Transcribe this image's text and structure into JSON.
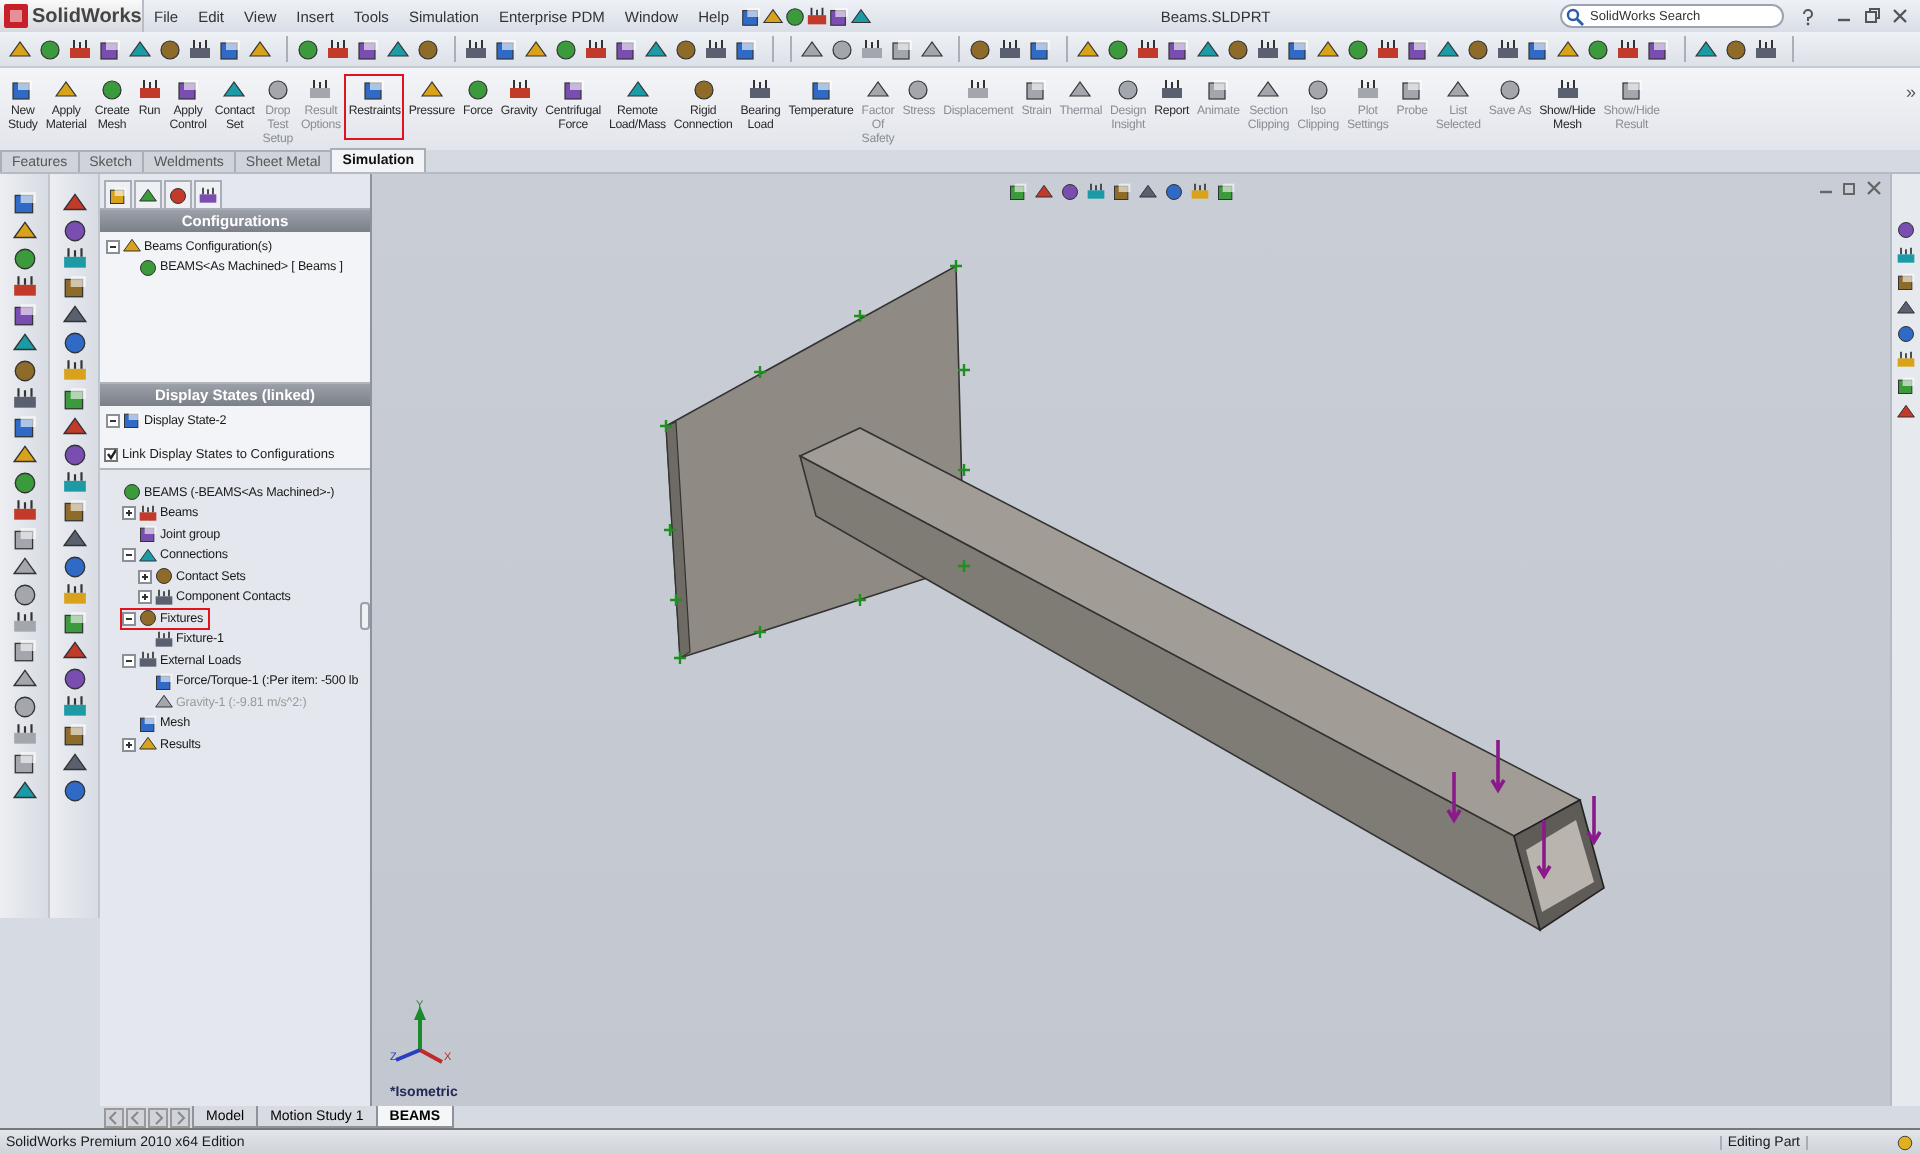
{
  "app": {
    "logo": "SolidWorks",
    "menu": [
      "File",
      "Edit",
      "View",
      "Insert",
      "Tools",
      "Simulation",
      "Enterprise PDM",
      "Window",
      "Help"
    ],
    "title": "Beams.SLDPRT",
    "search": {
      "placeholder": "SolidWorks Search"
    }
  },
  "commands": [
    {
      "label": "New\nStudy",
      "disabled": false,
      "highlighted": false
    },
    {
      "label": "Apply\nMaterial",
      "disabled": false,
      "highlighted": false
    },
    {
      "label": "Create\nMesh",
      "disabled": false,
      "highlighted": false
    },
    {
      "label": "Run",
      "disabled": false,
      "highlighted": false
    },
    {
      "label": "Apply\nControl",
      "disabled": false,
      "highlighted": false
    },
    {
      "label": "Contact\nSet",
      "disabled": false,
      "highlighted": false
    },
    {
      "label": "Drop\nTest\nSetup",
      "disabled": true,
      "highlighted": false
    },
    {
      "label": "Result\nOptions",
      "disabled": true,
      "highlighted": false
    },
    {
      "label": "Restraints",
      "disabled": false,
      "highlighted": true
    },
    {
      "label": "Pressure",
      "disabled": false,
      "highlighted": false
    },
    {
      "label": "Force",
      "disabled": false,
      "highlighted": false
    },
    {
      "label": "Gravity",
      "disabled": false,
      "highlighted": false
    },
    {
      "label": "Centrifugal\nForce",
      "disabled": false,
      "highlighted": false
    },
    {
      "label": "Remote\nLoad/Mass",
      "disabled": false,
      "highlighted": false
    },
    {
      "label": "Rigid\nConnection",
      "disabled": false,
      "highlighted": false
    },
    {
      "label": "Bearing\nLoad",
      "disabled": false,
      "highlighted": false
    },
    {
      "label": "Temperature",
      "disabled": false,
      "highlighted": false
    },
    {
      "label": "Factor\nOf\nSafety",
      "disabled": true,
      "highlighted": false
    },
    {
      "label": "Stress",
      "disabled": true,
      "highlighted": false
    },
    {
      "label": "Displacement",
      "disabled": true,
      "highlighted": false
    },
    {
      "label": "Strain",
      "disabled": true,
      "highlighted": false
    },
    {
      "label": "Thermal",
      "disabled": true,
      "highlighted": false
    },
    {
      "label": "Design\nInsight",
      "disabled": true,
      "highlighted": false
    },
    {
      "label": "Report",
      "disabled": false,
      "highlighted": false
    },
    {
      "label": "Animate",
      "disabled": true,
      "highlighted": false
    },
    {
      "label": "Section\nClipping",
      "disabled": true,
      "highlighted": false
    },
    {
      "label": "Iso\nClipping",
      "disabled": true,
      "highlighted": false
    },
    {
      "label": "Plot\nSettings",
      "disabled": true,
      "highlighted": false
    },
    {
      "label": "Probe",
      "disabled": true,
      "highlighted": false
    },
    {
      "label": "List\nSelected",
      "disabled": true,
      "highlighted": false
    },
    {
      "label": "Save As",
      "disabled": true,
      "highlighted": false
    },
    {
      "label": "Show/Hide\nMesh",
      "disabled": false,
      "highlighted": false
    },
    {
      "label": "Show/Hide\nResult",
      "disabled": true,
      "highlighted": false
    }
  ],
  "more": "»",
  "tabs": [
    {
      "label": "Features",
      "selected": false
    },
    {
      "label": "Sketch",
      "selected": false
    },
    {
      "label": "Weldments",
      "selected": false
    },
    {
      "label": "Sheet Metal",
      "selected": false
    },
    {
      "label": "Simulation",
      "selected": true
    }
  ],
  "configurations": {
    "title": "Configurations",
    "items": [
      {
        "label": "Beams Configuration(s)",
        "expanded": true,
        "disabled": false,
        "highlighted": false,
        "children": [
          {
            "label": "BEAMS<As Machined> [ Beams ]",
            "disabled": false,
            "highlighted": false
          }
        ]
      }
    ]
  },
  "display_states": {
    "title": "Display States (linked)",
    "items": [
      {
        "label": "Display State-2",
        "expanded": true,
        "disabled": false,
        "highlighted": false
      }
    ],
    "link": {
      "label": "Link Display States to Configurations",
      "checked": true
    }
  },
  "study_tree": [
    {
      "label": "BEAMS (-BEAMS<As Machined>-)",
      "disabled": false,
      "highlighted": false,
      "children": [
        {
          "label": "Beams",
          "expanded": false,
          "disabled": false,
          "highlighted": false
        },
        {
          "label": "Joint group",
          "disabled": false,
          "highlighted": false
        },
        {
          "label": "Connections",
          "expanded": true,
          "disabled": false,
          "highlighted": false,
          "children": [
            {
              "label": "Contact Sets",
              "expanded": false,
              "disabled": false,
              "highlighted": false
            },
            {
              "label": "Component Contacts",
              "expanded": false,
              "disabled": false,
              "highlighted": false
            }
          ]
        },
        {
          "label": "Fixtures",
          "expanded": true,
          "disabled": false,
          "highlighted": true,
          "children": [
            {
              "label": "Fixture-1",
              "disabled": false,
              "highlighted": false
            }
          ]
        },
        {
          "label": "External Loads",
          "expanded": true,
          "disabled": false,
          "highlighted": false,
          "children": [
            {
              "label": "Force/Torque-1 (:Per item: -500 lb",
              "disabled": false,
              "highlighted": false
            },
            {
              "label": "Gravity-1 (:-9.81 m/s^2:)",
              "disabled": true,
              "highlighted": false
            }
          ]
        },
        {
          "label": "Mesh",
          "disabled": false,
          "highlighted": false
        },
        {
          "label": "Results",
          "expanded": false,
          "disabled": false,
          "highlighted": false
        }
      ]
    }
  ],
  "viewport": {
    "view_label": "*Isometric",
    "triad": {
      "x": "X",
      "y": "Y",
      "z": "Z"
    }
  },
  "bottom_tabs": [
    {
      "label": "Model",
      "selected": false
    },
    {
      "label": "Motion Study 1",
      "selected": false
    },
    {
      "label": "BEAMS",
      "selected": true
    }
  ],
  "status_bar": {
    "edition": "SolidWorks Premium 2010 x64 Edition",
    "mode": "Editing Part"
  }
}
